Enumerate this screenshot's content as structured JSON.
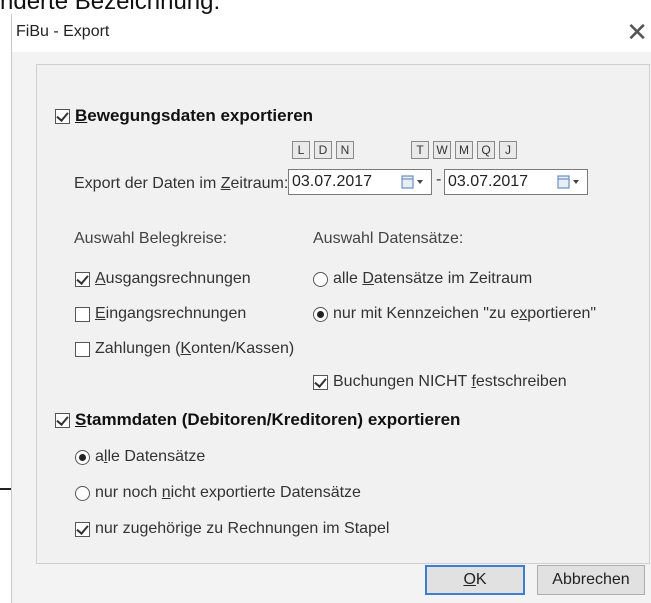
{
  "background_text": "nderte Bezeichnung:",
  "window": {
    "title": "FiBu - Export",
    "close_glyph": "✕"
  },
  "bewegungsdaten": {
    "checked": true,
    "label": "Bewegungsdaten exportieren",
    "mnemonic": "B",
    "label_rest": "ewegungsdaten exportieren"
  },
  "quick_buttons_left": [
    "L",
    "D",
    "N"
  ],
  "quick_buttons_right": [
    "T",
    "W",
    "M",
    "Q",
    "J"
  ],
  "zeitraum": {
    "label_pre": "Export der Daten im ",
    "label_mn": "Z",
    "label_post": "eitraum:",
    "from": "03.07.2017",
    "to": "03.07.2017",
    "separator": "-"
  },
  "belegkreise": {
    "header": "Auswahl Belegkreise:",
    "items": [
      {
        "pre": "",
        "mn": "A",
        "post": "usgangsrechnungen",
        "checked": true
      },
      {
        "pre": "",
        "mn": "E",
        "post": "ingangsrechnungen",
        "checked": false
      },
      {
        "pre": "Zahlungen (",
        "mn": "K",
        "post": "onten/Kassen)",
        "checked": false
      }
    ]
  },
  "datensaetze": {
    "header": "Auswahl Datensätze:",
    "items": [
      {
        "pre": "alle ",
        "mn": "D",
        "post": "atensätze im Zeitraum",
        "selected": false
      },
      {
        "pre": "nur mit Kennzeichen \"zu e",
        "mn": "x",
        "post": "portieren\"",
        "selected": true
      }
    ]
  },
  "buchungen": {
    "pre": "Buchungen NICHT ",
    "mn": "f",
    "post": "estschreiben",
    "checked": true
  },
  "stammdaten": {
    "checked": true,
    "mn": "S",
    "post": "tammdaten (Debitoren/Kreditoren) exportieren",
    "options": [
      {
        "pre": "a",
        "mn": "l",
        "post": "le Datensätze",
        "selected": true
      },
      {
        "pre": "nur noch ",
        "mn": "n",
        "post": "icht exportierte Datensätze",
        "selected": false
      }
    ],
    "zugehoerige": {
      "label": "nur zugehörige zu Rechnungen im Stapel",
      "checked": true
    }
  },
  "buttons": {
    "ok_mn": "O",
    "ok_post": "K",
    "cancel": "Abbrechen"
  },
  "colors": {
    "accent": "#3c7fd1",
    "calendar_icon": "#6f8fbf"
  }
}
